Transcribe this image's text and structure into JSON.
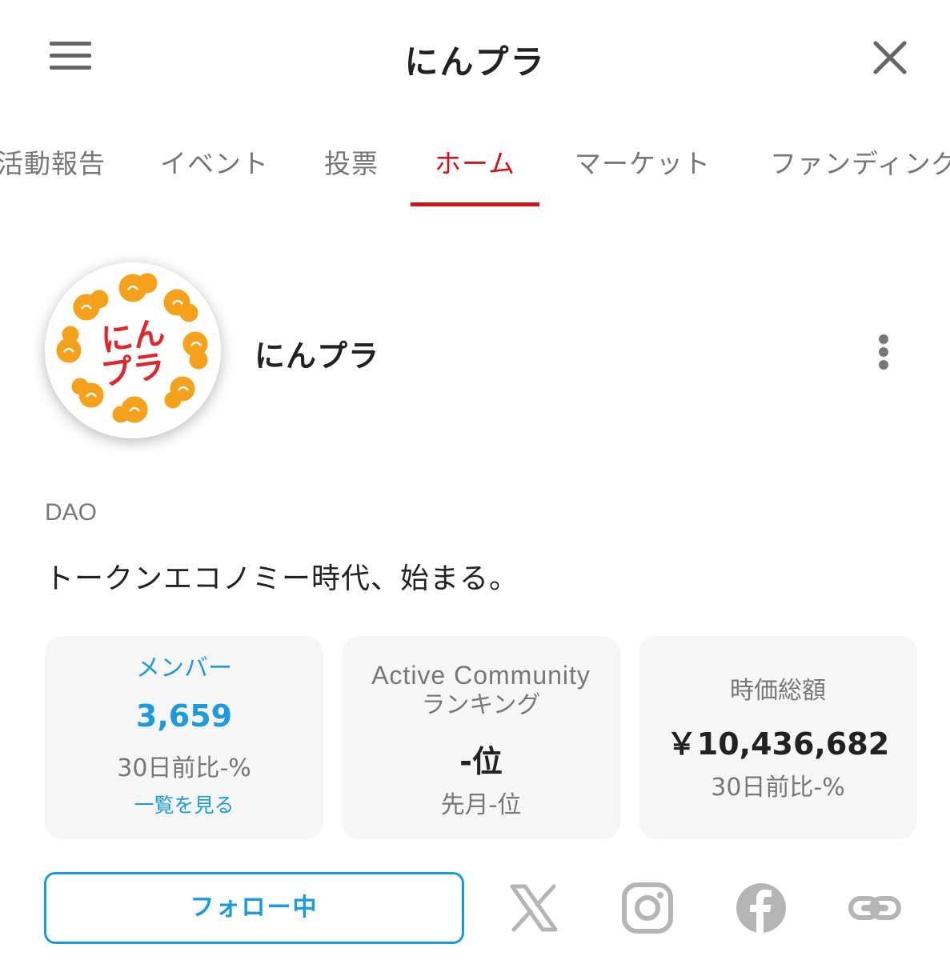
{
  "header": {
    "title": "にんプラ"
  },
  "tabs": [
    {
      "label": "活動報告"
    },
    {
      "label": "イベント"
    },
    {
      "label": "投票"
    },
    {
      "label": "ホーム"
    },
    {
      "label": "マーケット"
    },
    {
      "label": "ファンディング"
    }
  ],
  "active_tab": "ホーム",
  "profile": {
    "logo_text_line1": "にん",
    "logo_text_line2": "プラ",
    "name": "にんプラ",
    "category": "DAO",
    "tagline": "トークンエコノミー時代、始まる。"
  },
  "stats": {
    "members": {
      "label": "メンバー",
      "value": "3,659",
      "change": "30日前比-%",
      "link": "一覧を見る"
    },
    "ranking": {
      "label_line1": "Active Community",
      "label_line2": "ランキング",
      "value": "-位",
      "sub": "先月-位"
    },
    "market_cap": {
      "label": "時価総額",
      "value": "￥10,436,682",
      "change": "30日前比-%"
    }
  },
  "actions": {
    "follow_label": "フォロー中"
  },
  "social_icons": [
    "x-icon",
    "instagram-icon",
    "facebook-icon",
    "link-icon"
  ],
  "colors": {
    "accent_red": "#d0121b",
    "accent_blue": "#1a9be0",
    "logo_orange": "#f5a11c",
    "logo_red": "#e0262b",
    "card_bg": "#f6f6f6",
    "icon_gray": "#b5b5b5"
  }
}
